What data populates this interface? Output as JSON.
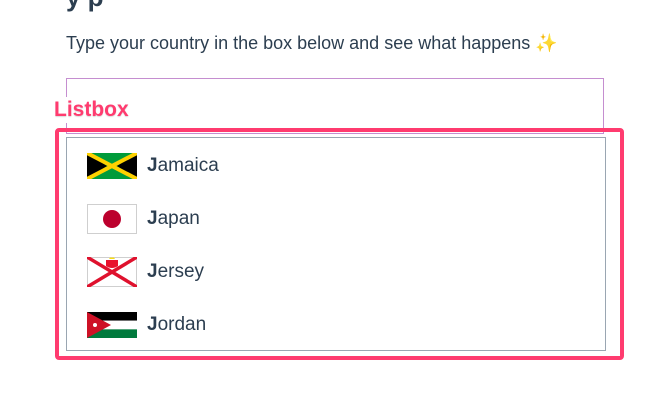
{
  "page": {
    "instructions": "Type your country in the box below and see what happens ✨",
    "heading_partial": "y p"
  },
  "annotation": {
    "label": "Listbox",
    "color": "#ff3b6f"
  },
  "combobox": {
    "value": ""
  },
  "listbox": {
    "options": [
      {
        "match": "J",
        "rest": "amaica",
        "flag": "jamaica-flag"
      },
      {
        "match": "J",
        "rest": "apan",
        "flag": "japan-flag"
      },
      {
        "match": "J",
        "rest": "ersey",
        "flag": "jersey-flag"
      },
      {
        "match": "J",
        "rest": "ordan",
        "flag": "jordan-flag"
      }
    ]
  }
}
